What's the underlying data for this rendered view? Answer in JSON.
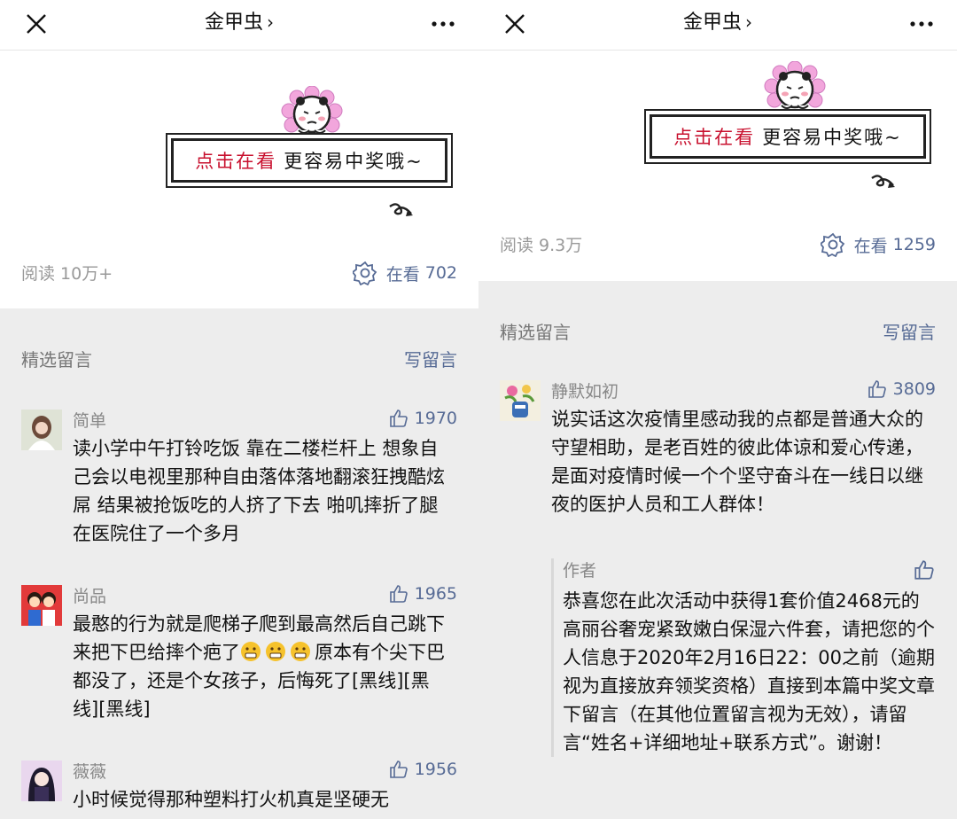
{
  "panels": [
    {
      "nav": {
        "title": "金甲虫",
        "chevron": "›"
      },
      "promo": {
        "highlight": "点击在看",
        "rest": "更容易中奖哦~"
      },
      "stats": {
        "reads_label": "阅读",
        "reads": "10万+",
        "watch_label": "在看",
        "watch_count": "702"
      },
      "section": {
        "title": "精选留言",
        "write": "写留言"
      },
      "comments": [
        {
          "name": "简单",
          "likes": "1970",
          "text": "读小学中午打铃吃饭 靠在二楼栏杆上 想象自己会以电视里那种自由落体落地翻滚狂拽酷炫屌 结果被抢饭吃的人挤了下去 啪叽摔折了腿 在医院住了一个多月"
        },
        {
          "name": "尚品",
          "likes": "1965",
          "text_a": "最憨的行为就是爬梯子爬到最高然后自己跳下来把下巴给摔个疤了",
          "text_b": "原本有个尖下巴都没了，还是个女孩子，后悔死了[黑线][黑线][黑线]"
        },
        {
          "name": "薇薇",
          "likes": "1956",
          "text": "小时候觉得那种塑料打火机真是坚硬无"
        }
      ]
    },
    {
      "nav": {
        "title": "金甲虫",
        "chevron": "›"
      },
      "promo": {
        "highlight": "点击在看",
        "rest": "更容易中奖哦~"
      },
      "stats": {
        "reads_label": "阅读",
        "reads": "9.3万",
        "watch_label": "在看",
        "watch_count": "1259"
      },
      "section": {
        "title": "精选留言",
        "write": "写留言"
      },
      "comments": [
        {
          "name": "静默如初",
          "likes": "3809",
          "text": "说实话这次疫情里感动我的点都是普通大众的守望相助，是老百姓的彼此体谅和爱心传递，是面对疫情时候一个个坚守奋斗在一线日以继夜的医护人员和工人群体！"
        }
      ],
      "reply": {
        "name": "作者",
        "text": "恭喜您在此次活动中获得1套价值2468元的高丽谷奢宠紧致嫩白保湿六件套，请把您的个人信息于2020年2月16日22：00之前（逾期视为直接放弃领奖资格）直接到本篇中奖文章下留言（在其他位置留言视为无效），请留言“姓名+详细地址+联系方式”。谢谢！"
      }
    }
  ],
  "colors": {
    "link": "#576b95",
    "highlight": "#c8102e",
    "gray_bg": "#ededed"
  },
  "icons": [
    "close-icon",
    "more-icon",
    "watching-icon",
    "thumbs-up-icon",
    "grimace-emoji-icon"
  ]
}
